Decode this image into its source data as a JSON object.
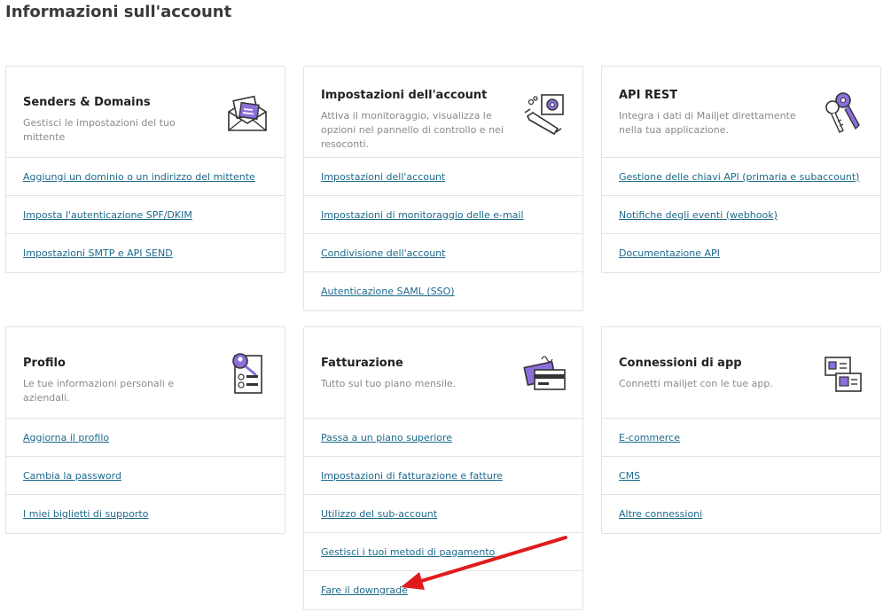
{
  "page": {
    "title": "Informazioni sull'account"
  },
  "cards": {
    "senders": {
      "title": "Senders & Domains",
      "desc": "Gestisci le impostazioni del tuo mittente",
      "icon": "envelope-icon",
      "links": [
        "Aggiungi un dominio o un indirizzo del mittente",
        "Imposta l'autenticazione SPF/DKIM",
        "Impostazioni SMTP e API SEND"
      ]
    },
    "account": {
      "title": "Impostazioni dell'account",
      "desc": "Attiva il monitoraggio, visualizza le opzioni nel pannello di controllo e nei resoconti.",
      "icon": "wrench-gear-icon",
      "links": [
        "Impostazioni dell'account",
        "Impostazioni di monitoraggio delle e-mail",
        "Condivisione dell'account",
        "Autenticazione SAML (SSO)"
      ]
    },
    "api": {
      "title": "API REST",
      "desc": "Integra i dati di Mailjet direttamente nella tua applicazione.",
      "icon": "keys-icon",
      "links": [
        "Gestione delle chiavi API (primaria e subaccount)",
        "Notifiche degli eventi (webhook)",
        "Documentazione API"
      ]
    },
    "profile": {
      "title": "Profilo",
      "desc": "Le tue informazioni personali e aziendali.",
      "icon": "profile-document-icon",
      "links": [
        "Aggiorna il profilo",
        "Cambia la password",
        "I miei biglietti di supporto"
      ]
    },
    "billing": {
      "title": "Fatturazione",
      "desc": "Tutto sul tuo piano mensile.",
      "icon": "credit-cards-icon",
      "links": [
        "Passa a un piano superiore",
        "Impostazioni di fatturazione e fatture",
        "Utilizzo del sub-account",
        "Gestisci i tuoi metodi di pagamento",
        "Fare il downgrade"
      ]
    },
    "apps": {
      "title": "Connessioni di app",
      "desc": "Connetti mailjet con le tue app.",
      "icon": "puzzle-cards-icon",
      "links": [
        "E-commerce",
        "CMS",
        "Altre connessioni"
      ]
    }
  },
  "colors": {
    "link": "#1d6a8c",
    "accent": "#8b6fdc",
    "annotation_arrow": "#e01b1b"
  }
}
